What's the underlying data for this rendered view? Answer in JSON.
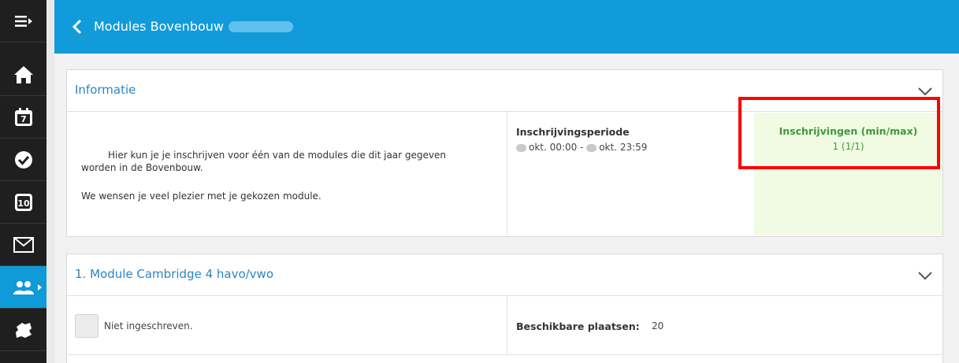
{
  "header": {
    "title": "Modules Bovenbouw",
    "background": "#119bda"
  },
  "sidebar": {
    "items": [
      {
        "icon": "menu-icon",
        "active": false
      },
      {
        "icon": "home-icon",
        "active": false
      },
      {
        "icon": "calendar-icon",
        "active": false
      },
      {
        "icon": "check-circle-icon",
        "active": false
      },
      {
        "icon": "grade-10-icon",
        "active": false
      },
      {
        "icon": "mail-icon",
        "active": false
      },
      {
        "icon": "group-icon",
        "active": true
      },
      {
        "icon": "puzzle-icon",
        "active": false
      }
    ]
  },
  "info_panel": {
    "title": "Informatie",
    "description_line1": "Hier kun je je inschrijven voor één van de modules die dit jaar gegeven",
    "description_line2": "worden in de Bovenbouw.",
    "description_line3": "We wensen je veel plezier met je gekozen module.",
    "period_label": "Inschrijvingsperiode",
    "period_start": "okt. 00:00 -",
    "period_end": "okt. 23:59",
    "registrations_label": "Inschrijvingen (min/max)",
    "registrations_value": "1 (1/1)",
    "registrations_color": "#3c9a3c"
  },
  "module_panel": {
    "title": "1. Module Cambridge 4 havo/vwo",
    "status": "Niet ingeschreven.",
    "available_label": "Beschikbare plaatsen:",
    "available_value": "20"
  },
  "highlight_color": "#ff0000"
}
